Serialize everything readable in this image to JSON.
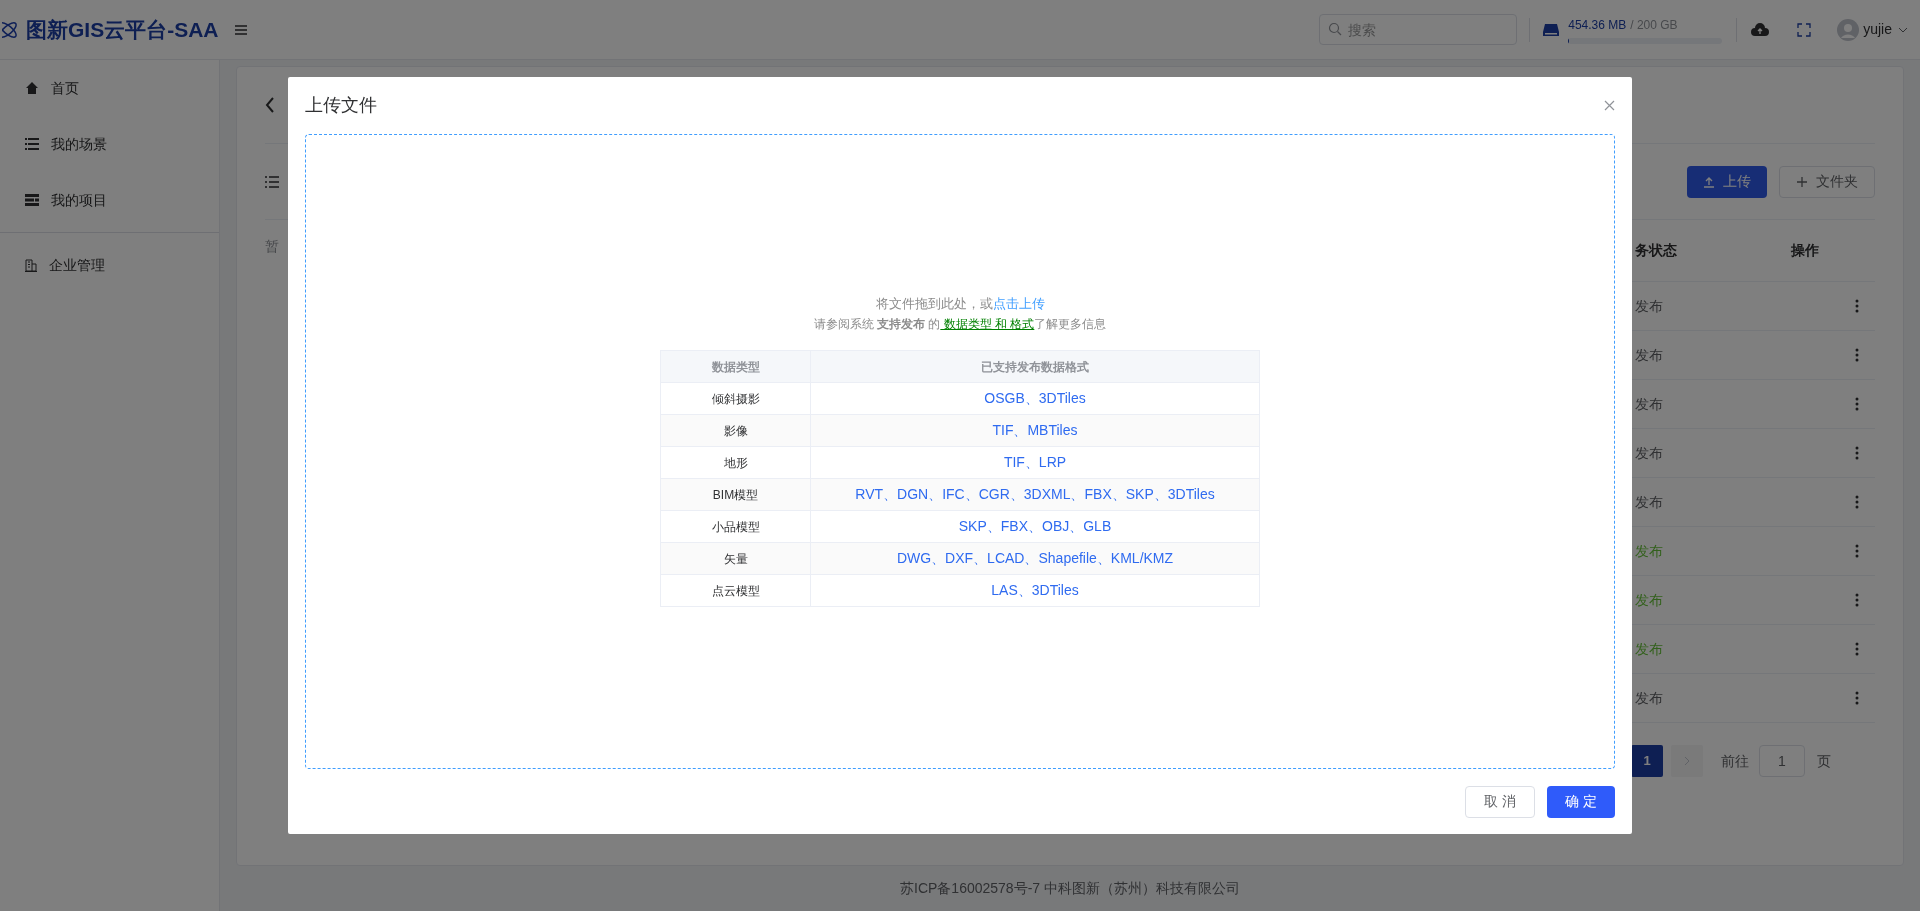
{
  "header": {
    "logo": "图新GIS云平台-SAA",
    "search": {
      "placeholder": "搜索"
    },
    "storage": {
      "used": "454.36 MB",
      "total": "/ 200 GB",
      "level": 0.002
    },
    "user": "yujie"
  },
  "sidebar": {
    "groups": [
      [
        {
          "label": "首页",
          "kind": "home"
        },
        {
          "label": "我的场景",
          "kind": "list"
        },
        {
          "label": "我的项目",
          "kind": "project"
        }
      ],
      [
        {
          "label": "企业管理",
          "kind": "building"
        }
      ]
    ]
  },
  "page": {
    "empty_text": "暂",
    "buttons": [
      {
        "label": "上传",
        "kind": "primary"
      },
      {
        "label": "文件夹",
        "kind": "default"
      }
    ],
    "table": {
      "columns": [
        "务状态",
        "操作"
      ],
      "rows": [
        {
          "status": "发布",
          "published": false
        },
        {
          "status": "发布",
          "published": false
        },
        {
          "status": "发布",
          "published": false
        },
        {
          "status": "发布",
          "published": false
        },
        {
          "status": "发布",
          "published": false
        },
        {
          "status": "发布",
          "published": true
        },
        {
          "status": "发布",
          "published": true
        },
        {
          "status": "发布",
          "published": true
        },
        {
          "status": "发布",
          "published": false
        }
      ]
    },
    "pagination": {
      "current": "1",
      "goto_label": "前往",
      "goto_value": "1",
      "suffix": "页"
    }
  },
  "footer": "苏ICP备16002578号-7 中科图新（苏州）科技有限公司",
  "dialog": {
    "title": "上传文件",
    "hint": "将文件拖到此处，或",
    "hint_link": "点击上传",
    "info": "请参阅系统 **支持发布** 的",
    "info_link": " 数据类型 和 格式",
    "info_suffix": "了解更多信息",
    "table": {
      "columns": [
        "数据类型",
        "已支持发布数据格式"
      ],
      "rows": [
        {
          "type": "倾斜摄影",
          "formats": "OSGB、3DTiles"
        },
        {
          "type": "影像",
          "formats": "TIF、MBTiles"
        },
        {
          "type": "地形",
          "formats": "TIF、LRP"
        },
        {
          "type": "BIM模型",
          "formats": "RVT、DGN、IFC、CGR、3DXML、FBX、SKP、3DTiles"
        },
        {
          "type": "小品模型",
          "formats": "SKP、FBX、OBJ、GLB"
        },
        {
          "type": "矢量",
          "formats": "DWG、DXF、LCAD、Shapefile、KML/KMZ"
        },
        {
          "type": "点云模型",
          "formats": "LAS、3DTiles"
        }
      ]
    },
    "buttons": [
      {
        "label": "取 消",
        "kind": "default"
      },
      {
        "label": "确 定",
        "kind": "primary"
      }
    ]
  }
}
